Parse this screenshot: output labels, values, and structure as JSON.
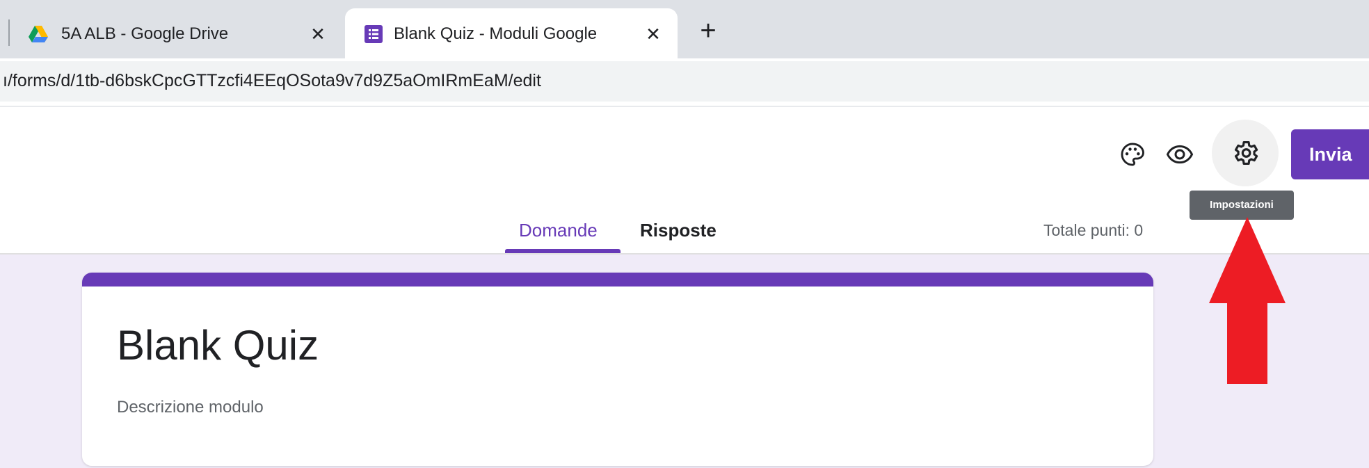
{
  "browser": {
    "tabs": [
      {
        "title": "5A ALB - Google Drive",
        "icon": "google-drive-icon",
        "active": false
      },
      {
        "title": "Blank Quiz - Moduli Google",
        "icon": "google-forms-icon",
        "active": true
      }
    ],
    "close_glyph": "✕",
    "new_tab_glyph": "+",
    "url": "ı/forms/d/1tb-d6bskCpcGTTzcfi4EEqOSota9v7d9Z5aOmIRmEaM/edit"
  },
  "header": {
    "icons": [
      "palette-icon",
      "eye-icon",
      "gear-icon"
    ],
    "send_label": "Invia",
    "tooltip": "Impostazioni"
  },
  "form_tabs": {
    "questions": "Domande",
    "responses": "Risposte",
    "total_points": "Totale punti: 0"
  },
  "form": {
    "title": "Blank Quiz",
    "description": "Descrizione modulo"
  },
  "colors": {
    "accent": "#673ab7",
    "background": "#f0ebf8",
    "arrow": "#ed1c24"
  }
}
